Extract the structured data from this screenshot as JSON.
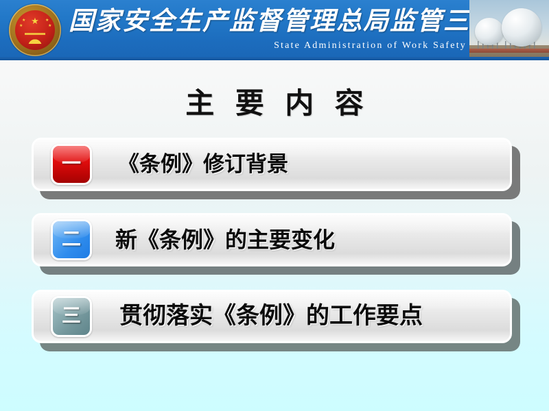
{
  "banner": {
    "emblem_name": "national-emblem",
    "title_cn": "国家安全生产监督管理总局监管三司",
    "subtitle_en": "State  Administration  of  Work  Safety",
    "photo_caption": "spherical-storage-tanks",
    "bg_color": "#2278c8",
    "text_color": "#ffffff"
  },
  "slide": {
    "title": "主 要 内 容",
    "background_top": "#fbfbfa",
    "background_bottom": "#cdfdff"
  },
  "rows": [
    {
      "number": "一",
      "label": "《条例》修订背景",
      "badge_color": "#e00d0d",
      "badge_name": "badge-one"
    },
    {
      "number": "二",
      "label": "新《条例》的主要变化",
      "badge_color": "#2f8ced",
      "badge_name": "badge-two"
    },
    {
      "number": "三",
      "label": "贯彻落实《条例》的工作要点",
      "badge_color": "#74979c",
      "badge_name": "badge-three"
    }
  ]
}
